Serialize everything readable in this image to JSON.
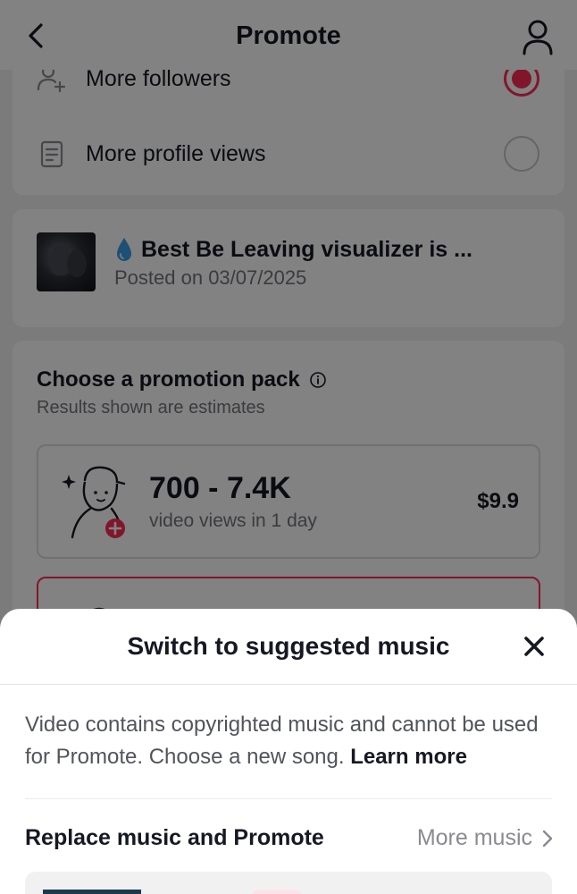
{
  "header": {
    "title": "Promote"
  },
  "goals": [
    {
      "label": "More followers",
      "selected": true,
      "icon": "add-user-icon"
    },
    {
      "label": "More profile views",
      "selected": false,
      "icon": "document-icon"
    }
  ],
  "video": {
    "title": "Best Be Leaving visualizer is ...",
    "posted": "Posted on 03/07/2025",
    "emoji_icon": "water-drop-icon"
  },
  "promotion": {
    "title": "Choose a promotion pack",
    "subtitle": "Results shown are estimates",
    "packs": [
      {
        "range": "700 - 7.4K",
        "desc": "video views in 1 day",
        "price": "$9.9"
      }
    ]
  },
  "sheet": {
    "title": "Switch to suggested music",
    "message": "Video contains copyrighted music and cannot be used for Promote. Choose a new song.",
    "learn_more": "Learn more",
    "replace_label": "Replace music and Promote",
    "more_music": "More music"
  },
  "colors": {
    "accent": "#fe2c55",
    "text_primary": "#161823",
    "text_secondary": "#73757c",
    "overlay": "rgba(0,0,0,0.49)"
  }
}
